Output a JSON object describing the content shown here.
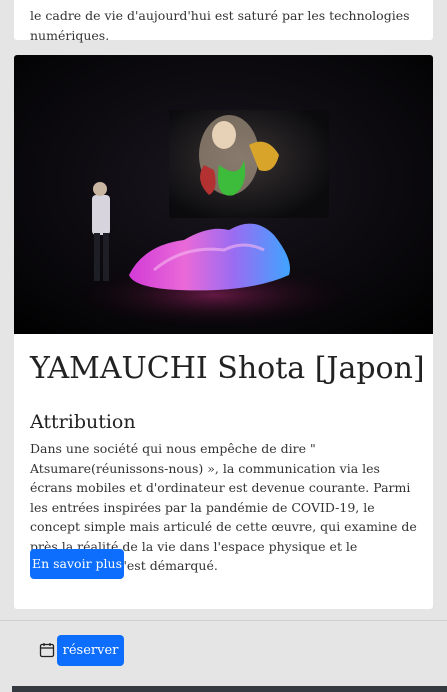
{
  "intro": {
    "text": "le cadre de vie d'aujourd'hui est saturé par les technologies numériques."
  },
  "artist": {
    "name": "YAMAUCHI Shota [Japon]",
    "section_title": "Attribution",
    "description": "Dans une société qui nous empêche de dire \" Atsumare(réunissons-nous) », la communication via les écrans mobiles et d'ordinateur est devenue courante. Parmi les entrées inspirées par la pandémie de COVID-19, le concept simple mais articulé de cette œuvre, qui examine de près la réalité de la vie dans l'espace physique et le cyberespace, s'est démarqué.",
    "more_button": "En savoir plus"
  },
  "booking": {
    "icon": "calendar-icon",
    "reserve_button": "réserver"
  },
  "colors": {
    "accent": "#0d6efd",
    "page_bg": "#e5e5e5",
    "card_bg": "#ffffff",
    "footer": "#343a40"
  }
}
